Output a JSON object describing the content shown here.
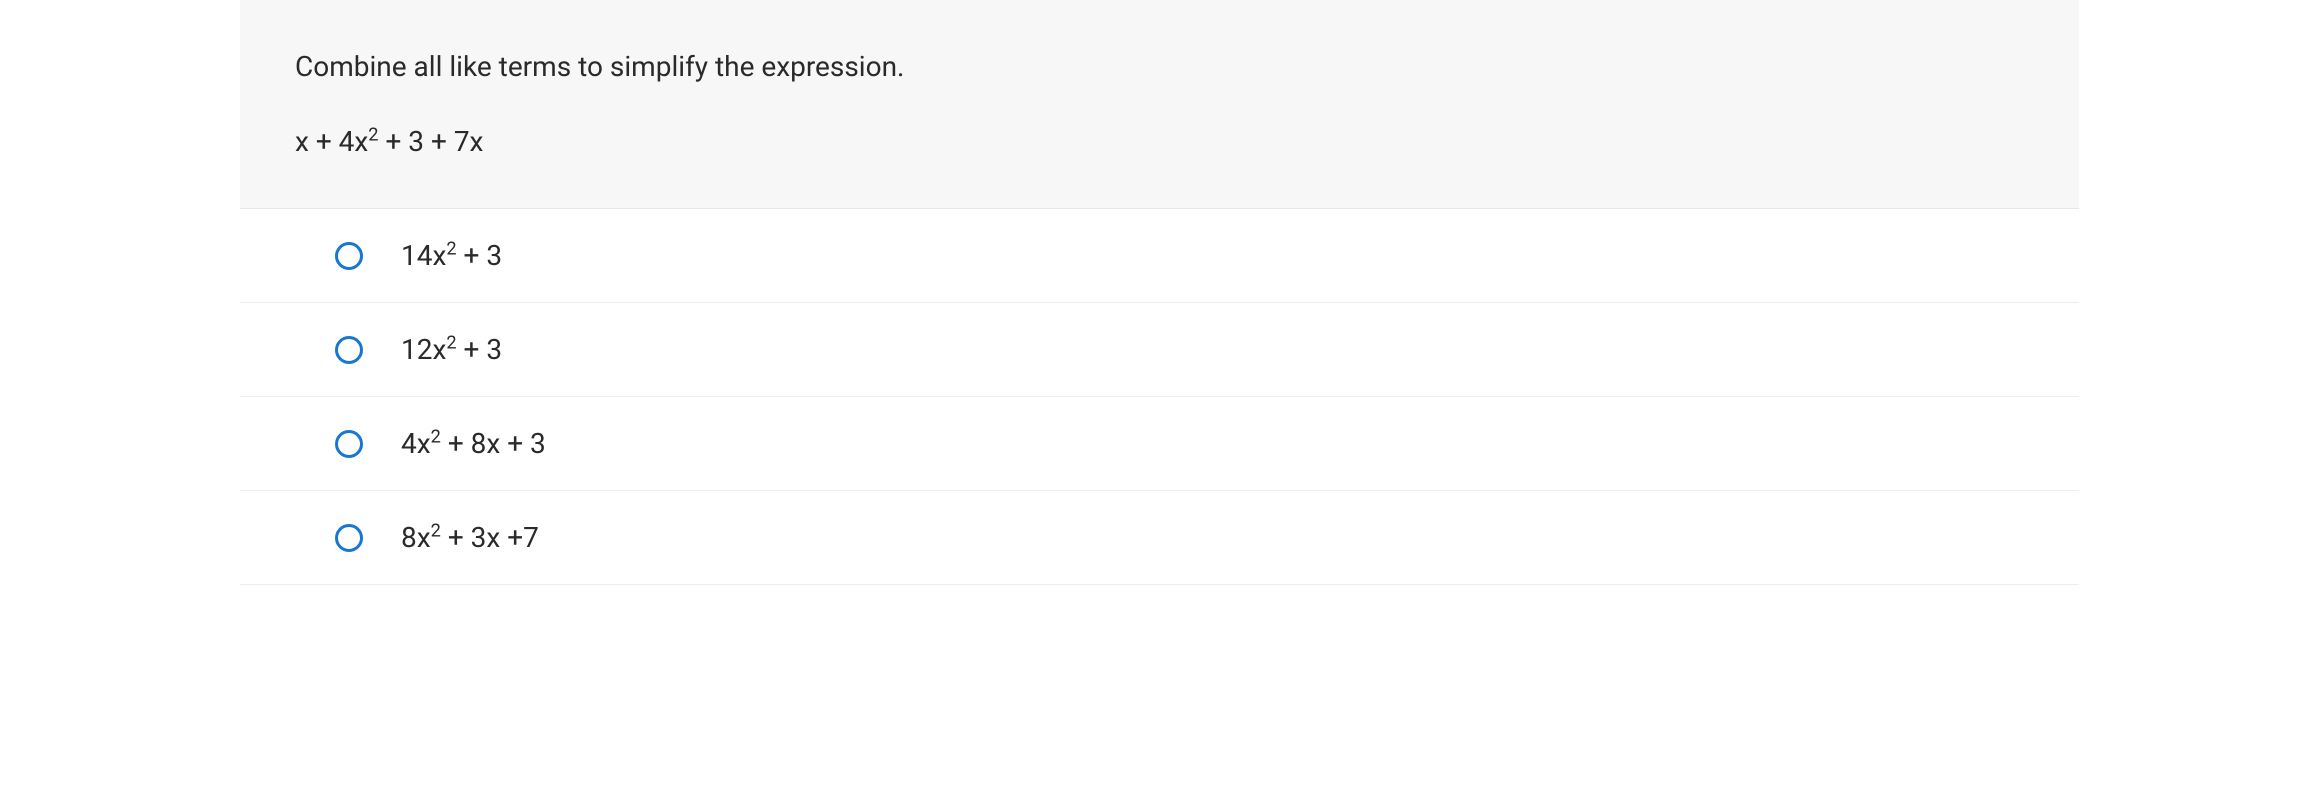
{
  "question": {
    "prompt": "Combine all like terms to simplify the expression.",
    "expression_parts": {
      "prefix": "x + 4x",
      "exp1": "2",
      "suffix": " + 3 + 7x"
    }
  },
  "options": [
    {
      "prefix": "14x",
      "exp": "2",
      "suffix": " + 3"
    },
    {
      "prefix": "12x",
      "exp": "2",
      "suffix": " + 3"
    },
    {
      "prefix": "4x",
      "exp": "2",
      "suffix": " + 8x + 3"
    },
    {
      "prefix": "8x",
      "exp": "2",
      "suffix": " + 3x +7"
    }
  ]
}
